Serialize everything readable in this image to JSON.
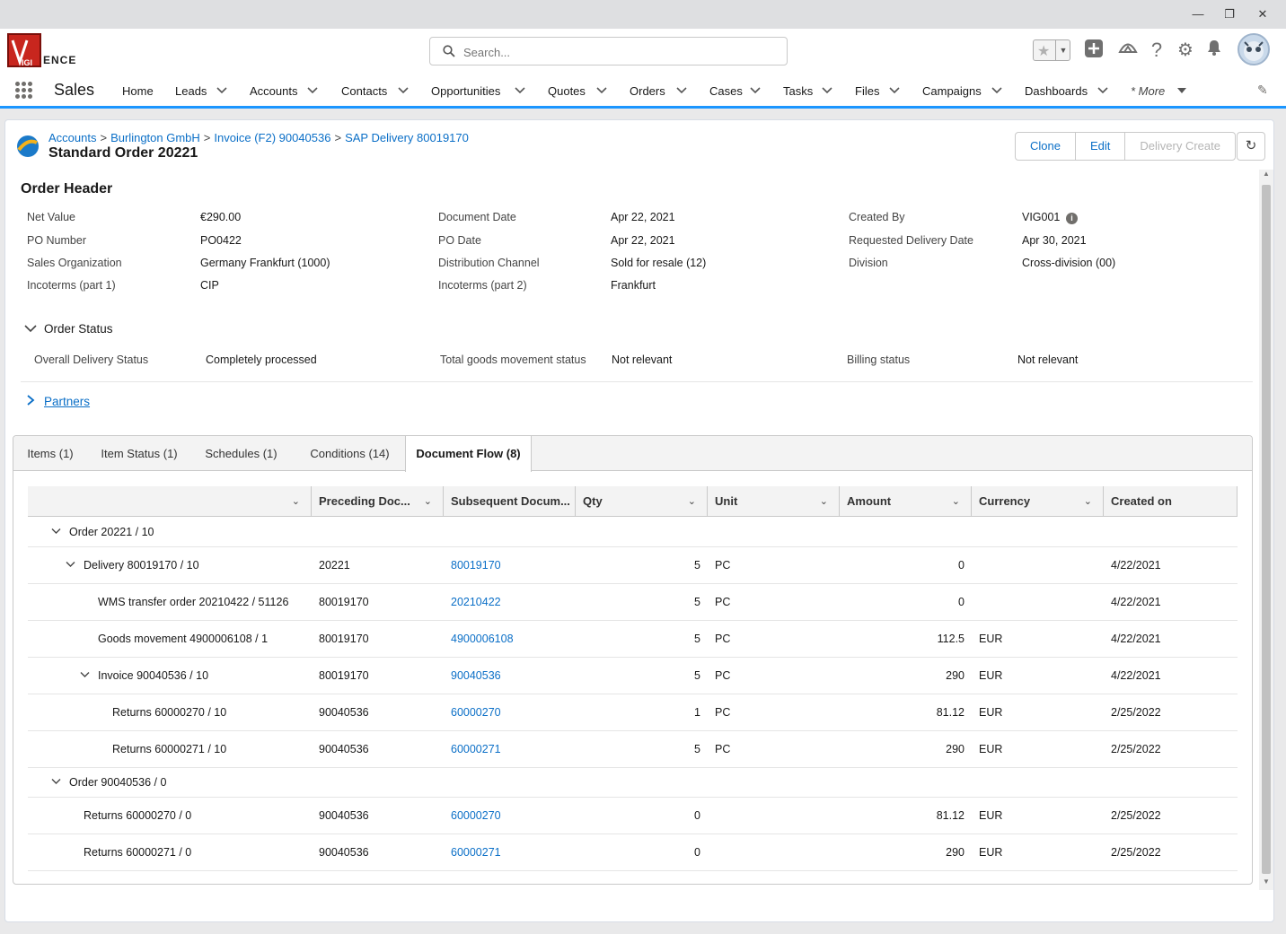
{
  "window": {
    "minimize": "—",
    "restore": "❐",
    "close": "✕"
  },
  "brand": {
    "logo_text": "ENCE",
    "logo_mark": "VIGI"
  },
  "search": {
    "placeholder": "Search..."
  },
  "app": {
    "name": "Sales"
  },
  "nav": {
    "items": [
      "Home",
      "Leads",
      "Accounts",
      "Contacts",
      "Opportunities",
      "Quotes",
      "Orders",
      "Cases",
      "Tasks",
      "Files",
      "Campaigns",
      "Dashboards",
      "* More"
    ]
  },
  "record": {
    "breadcrumb": [
      "Accounts",
      "Burlington GmbH",
      "Invoice (F2) 90040536",
      "SAP Delivery 80019170"
    ],
    "breadcrumb_sep": ">",
    "title": "Standard Order 20221",
    "actions": [
      "Clone",
      "Edit",
      "Delivery Create"
    ],
    "refresh": "↻"
  },
  "order_header": {
    "title": "Order Header",
    "fields": [
      {
        "label": "Net Value",
        "value": "€290.00"
      },
      {
        "label": "Document Date",
        "value": "Apr 22, 2021"
      },
      {
        "label": "Created By",
        "value": "VIG001"
      },
      {
        "label": "PO Number",
        "value": "PO0422"
      },
      {
        "label": "PO Date",
        "value": "Apr 22, 2021"
      },
      {
        "label": "Requested Delivery Date",
        "value": "Apr 30, 2021"
      },
      {
        "label": "Sales Organization",
        "value": "Germany Frankfurt (1000)"
      },
      {
        "label": "Distribution Channel",
        "value": "Sold for resale (12)"
      },
      {
        "label": "Division",
        "value": "Cross-division (00)"
      },
      {
        "label": "Incoterms (part 1)",
        "value": "CIP"
      },
      {
        "label": "Incoterms (part 2)",
        "value": "Frankfurt"
      }
    ]
  },
  "order_status": {
    "title": "Order Status",
    "fields": [
      {
        "label": "Overall Delivery Status",
        "value": "Completely processed"
      },
      {
        "label": "Total goods movement status",
        "value": "Not relevant"
      },
      {
        "label": "Billing status",
        "value": "Not relevant"
      }
    ]
  },
  "partners": {
    "title": "Partners"
  },
  "tabs": [
    "Items (1)",
    "Item Status (1)",
    "Schedules (1)",
    "Conditions (14)",
    "Document Flow (8)"
  ],
  "active_tab": "Document Flow (8)",
  "grid": {
    "columns": [
      "",
      "Preceding Doc...",
      "Subsequent Docum...",
      "Qty",
      "Unit",
      "Amount",
      "Currency",
      "Created on"
    ],
    "rows": [
      {
        "name": "Order 20221 / 10",
        "level": 1,
        "group": true,
        "preceding": "",
        "subsequent": "",
        "qty": "",
        "unit": "",
        "amount": "",
        "currency": "",
        "created": ""
      },
      {
        "name": "Delivery 80019170 / 10",
        "level": 2,
        "expandable": true,
        "preceding": "20221",
        "subsequent": "80019170",
        "qty": "5",
        "unit": "PC",
        "amount": "0",
        "currency": "",
        "created": "4/22/2021"
      },
      {
        "name": "WMS transfer order 20210422 / 51126",
        "level": 3,
        "preceding": "80019170",
        "subsequent": "20210422",
        "qty": "5",
        "unit": "PC",
        "amount": "0",
        "currency": "",
        "created": "4/22/2021"
      },
      {
        "name": "Goods movement 4900006108 / 1",
        "level": 3,
        "preceding": "80019170",
        "subsequent": "4900006108",
        "qty": "5",
        "unit": "PC",
        "amount": "112.5",
        "currency": "EUR",
        "created": "4/22/2021"
      },
      {
        "name": "Invoice 90040536 / 10",
        "level": 3,
        "expandable": true,
        "preceding": "80019170",
        "subsequent": "90040536",
        "qty": "5",
        "unit": "PC",
        "amount": "290",
        "currency": "EUR",
        "created": "4/22/2021"
      },
      {
        "name": "Returns 60000270 / 10",
        "level": 4,
        "preceding": "90040536",
        "subsequent": "60000270",
        "qty": "1",
        "unit": "PC",
        "amount": "81.12",
        "currency": "EUR",
        "created": "2/25/2022"
      },
      {
        "name": "Returns 60000271 / 10",
        "level": 4,
        "preceding": "90040536",
        "subsequent": "60000271",
        "qty": "5",
        "unit": "PC",
        "amount": "290",
        "currency": "EUR",
        "created": "2/25/2022"
      },
      {
        "name": "Order 90040536 / 0",
        "level": 1,
        "group": true,
        "preceding": "",
        "subsequent": "",
        "qty": "",
        "unit": "",
        "amount": "",
        "currency": "",
        "created": ""
      },
      {
        "name": "Returns 60000270 / 0",
        "level": 2,
        "preceding": "90040536",
        "subsequent": "60000270",
        "qty": "0",
        "unit": "",
        "amount": "81.12",
        "currency": "EUR",
        "created": "2/25/2022"
      },
      {
        "name": "Returns 60000271 / 0",
        "level": 2,
        "preceding": "90040536",
        "subsequent": "60000271",
        "qty": "0",
        "unit": "",
        "amount": "290",
        "currency": "EUR",
        "created": "2/25/2022"
      }
    ]
  },
  "colors": {
    "accent": "#1b96ff",
    "link": "#0b6fc7",
    "logo_red": "#c8261e"
  }
}
